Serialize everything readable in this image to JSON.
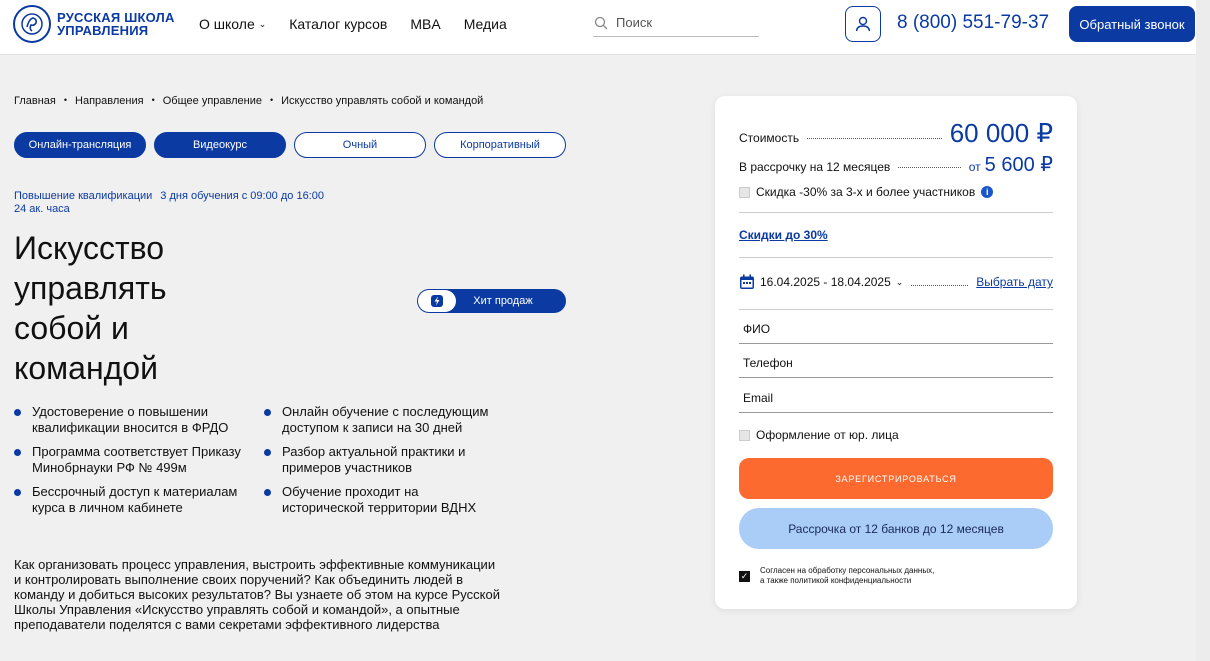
{
  "header": {
    "logo_line1": "РУССКАЯ ШКОЛА",
    "logo_line2": "УПРАВЛЕНИЯ",
    "nav": [
      {
        "label": "О школе",
        "has_dropdown": true
      },
      {
        "label": "Каталог курсов",
        "has_dropdown": false
      },
      {
        "label": "MBA",
        "has_dropdown": false
      },
      {
        "label": "Медиа",
        "has_dropdown": false
      }
    ],
    "search_placeholder": "Поиск",
    "phone": "8 (800) 551-79-37",
    "callback_label": "Обратный звонок"
  },
  "breadcrumb": [
    "Главная",
    "Направления",
    "Общее управление",
    "Искусство управлять собой и командой"
  ],
  "formats": [
    {
      "label": "Онлайн-трансляция",
      "active": true
    },
    {
      "label": "Видеокурс",
      "active": true
    },
    {
      "label": "Очный",
      "active": false
    },
    {
      "label": "Корпоративный",
      "active": false
    }
  ],
  "course_meta": {
    "type": "Повышение квалификации",
    "schedule": "3 дня обучения с 09:00 до 16:00",
    "hours": "24 ак. часа"
  },
  "title": "Искусство управлять собой и командой",
  "hit_badge": "Хит продаж",
  "features_left": [
    "Удостоверение о повышении квалификации вносится в ФРДО",
    "Программа соответствует Приказу Минобрнауки РФ № 499м",
    "Бессрочный доступ к материалам курса в личном кабинете"
  ],
  "features_right": [
    "Онлайн обучение с последующим доступом к записи на 30 дней",
    "Разбор актуальной практики и примеров участников",
    "Обучение проходит на исторической территории ВДНХ"
  ],
  "description": "Как организовать процесс управления, выстроить эффективные коммуникации и контролировать выполнение своих поручений? Как объединить людей в команду и добиться высоких результатов? Вы узнаете об этом на курсе Русской Школы Управления «Искусство управлять собой и командой», а опытные преподаватели поделятся с вами секретами эффективного лидерства",
  "form": {
    "price_label": "Стоимость",
    "price": "60 000 ₽",
    "installment_label": "В рассрочку на 12 месяцев",
    "installment_from": "от",
    "installment_price": "5 600 ₽",
    "group_discount": "Скидка -30% за 3-х и более участников",
    "discounts_link": "Скидки до 30%",
    "dates": "16.04.2025 - 18.04.2025",
    "choose_date": "Выбрать дату",
    "field_name": "ФИО",
    "field_phone": "Телефон",
    "field_email": "Email",
    "legal_entity": "Оформление от юр. лица",
    "register_btn": "ЗАРЕГИСТРИРОВАТЬСЯ",
    "installment_btn": "Рассрочка от 12 банков до 12 месяцев",
    "consent_line1": "Согласен на обработку персональных данных,",
    "consent_line2": "а также политикой конфиденциальности"
  },
  "colors": {
    "brand_blue": "#0b3aa3",
    "register_orange": "#fd6a2f",
    "installment_blue": "#a9cdf6",
    "page_bg": "#f0f0f0"
  }
}
